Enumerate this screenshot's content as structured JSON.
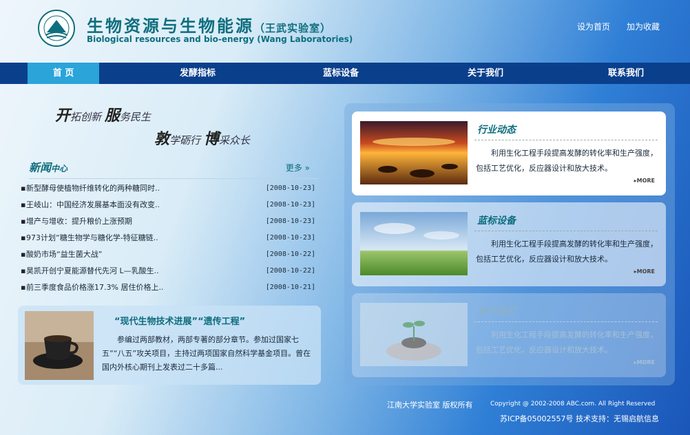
{
  "header": {
    "title_cn": "生物资源与生物能源",
    "title_cn_sub": "（王武实验室）",
    "title_en": "Biological resources and bio-energy (Wang Laboratories)",
    "set_home": "设为首页",
    "add_favorite": "加为收藏"
  },
  "nav": {
    "items": [
      {
        "label": "首 页"
      },
      {
        "label": "发酵指标"
      },
      {
        "label": "蓝标设备"
      },
      {
        "label": "关于我们"
      },
      {
        "label": "联系我们"
      }
    ]
  },
  "slogan": {
    "line1_a": "开",
    "line1_b": "拓创新",
    "line1_c": "服",
    "line1_d": "务民生",
    "line2_a": "敦",
    "line2_b": "学砺行",
    "line2_c": "博",
    "line2_d": "采众长"
  },
  "news": {
    "title": "新闻",
    "title_small": "中心",
    "more": "更多 »",
    "items": [
      {
        "text": "新型酵母使植物纤维转化的两种糖同时..",
        "date": "[2008-10-23]"
      },
      {
        "text": "王岐山：中国经济发展基本面没有改变..",
        "date": "[2008-10-23]"
      },
      {
        "text": "增产与增收：提升粮价上涨预期",
        "date": "[2008-10-23]"
      },
      {
        "text": "973计划“糖生物学与糖化学-特征糖链..",
        "date": "[2008-10-23]"
      },
      {
        "text": "酸奶市场“益生菌大战”",
        "date": "[2008-10-22]"
      },
      {
        "text": "昊凯开创宁夏能源替代先河 L—乳酸生..",
        "date": "[2008-10-22]"
      },
      {
        "text": "前三季度食品价格涨17.3% 居住价格上..",
        "date": "[2008-10-21]"
      }
    ]
  },
  "feature": {
    "title": "“现代生物技术进展”“遗传工程”",
    "text": "参编过两部教材，两部专著的部分章节。参加过国家七五”“八五”攻关项目，主持过两项国家自然科学基金项目。曾在国内外核心期刊上发表过二十多篇..."
  },
  "cards": [
    {
      "title": "行业动态",
      "text": "利用生化工程手段提高发酵的转化率和生产强度，包括工艺优化，反应器设计和放大技术。",
      "more": "MORE"
    },
    {
      "title": "蓝标设备",
      "text": "利用生化工程手段提高发酵的转化率和生产强度，包括工艺优化，反应器设计和放大技术。",
      "more": "MORE"
    },
    {
      "title": "关于我们",
      "text": "利用生化工程手段提高发酵的转化率和生产强度，包括工艺优化，反应器设计和放大技术。",
      "more": "MORE"
    }
  ],
  "footer": {
    "copyright_cn": "江南大学实验室  版权所有",
    "copyright_en": "Copyright @ 2002-2008 ABC.com. All Right Reserved",
    "icp": "苏ICP备05002557号  技术支持：无锡启航信息"
  },
  "colors": {
    "nav_bg": "#0a3f8c",
    "nav_active": "#2aa4d9",
    "brand_teal": "#0e6e7e"
  }
}
